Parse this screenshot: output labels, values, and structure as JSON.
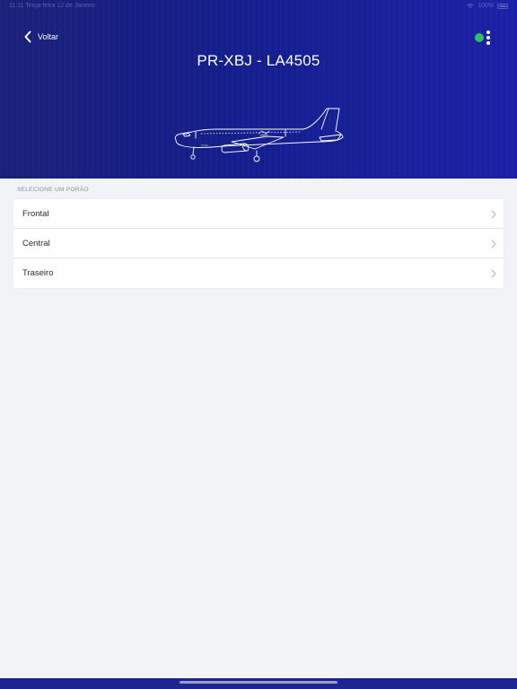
{
  "status_bar": {
    "left_text": "11:11 Terça-feira 12 de Janeiro",
    "battery": "100%"
  },
  "header": {
    "back_label": "Voltar",
    "title": "PR-XBJ - LA4505",
    "status_color": "#2fbf5f",
    "gradient_colors": [
      "#1a1f78",
      "#141e8c",
      "#1b21a6"
    ]
  },
  "section": {
    "label": "SELECIONE UM PORÃO"
  },
  "list": {
    "items": [
      {
        "label": "Frontal"
      },
      {
        "label": "Central"
      },
      {
        "label": "Traseiro"
      }
    ]
  },
  "icons": {
    "back": "chevron-left-icon",
    "more": "more-vertical-icon",
    "row": "chevron-right-icon",
    "plane": "airplane-outline-icon"
  }
}
